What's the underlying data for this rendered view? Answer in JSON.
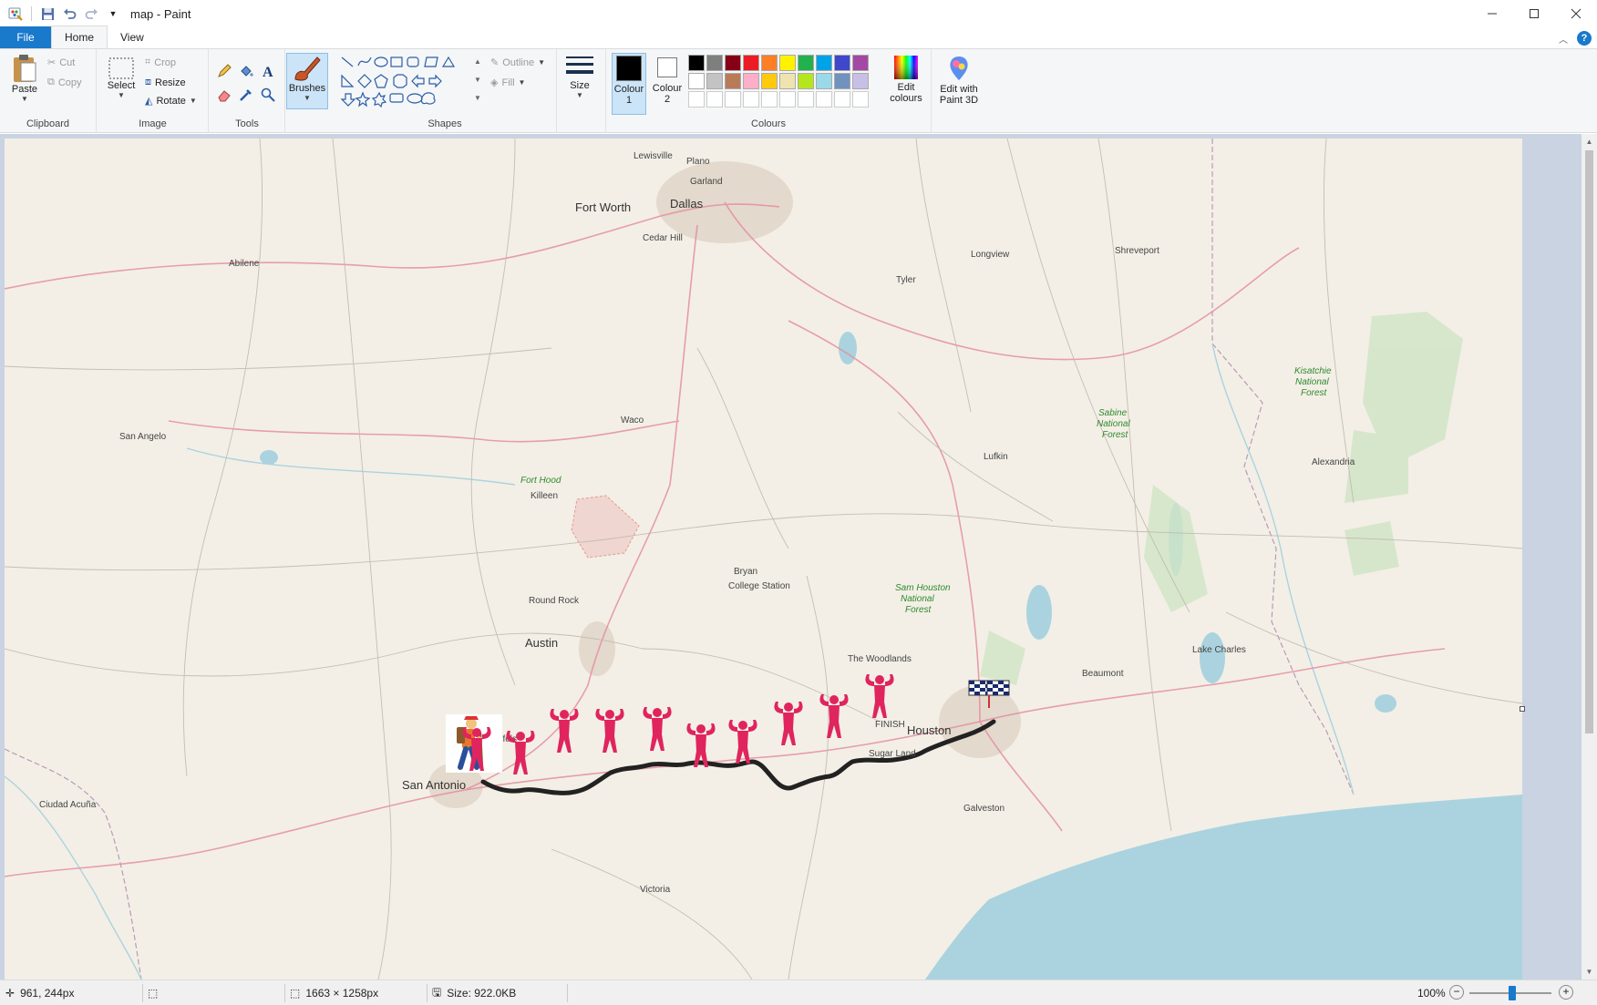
{
  "window": {
    "title": "map - Paint",
    "minimize_icon": "minimize-icon",
    "maximize_icon": "maximize-icon",
    "close_icon": "close-icon"
  },
  "tabs": [
    "File",
    "Home",
    "View"
  ],
  "ribbon": {
    "clipboard": {
      "label": "Clipboard",
      "paste": "Paste",
      "cut": "Cut",
      "copy": "Copy"
    },
    "image": {
      "label": "Image",
      "select": "Select",
      "crop": "Crop",
      "resize": "Resize",
      "rotate": "Rotate"
    },
    "tools": {
      "label": "Tools"
    },
    "brushes": "Brushes",
    "shapes": {
      "label": "Shapes",
      "outline": "Outline",
      "fill": "Fill"
    },
    "size": "Size",
    "colours": {
      "label": "Colours",
      "colour1": "Colour 1",
      "colour2": "Colour 2",
      "edit_colours": "Edit colours",
      "row1": [
        "#000000",
        "#7f7f7f",
        "#880015",
        "#ed1c24",
        "#ff7f27",
        "#fff200",
        "#22b14c",
        "#00a2e8",
        "#3f48cc",
        "#a349a4"
      ],
      "row2": [
        "#ffffff",
        "#c3c3c3",
        "#b97a57",
        "#ffaec9",
        "#ffc90e",
        "#efe4b0",
        "#b5e61d",
        "#99d9ea",
        "#7092be",
        "#c8bfe7"
      ]
    },
    "paint3d": "Edit with Paint 3D"
  },
  "map": {
    "labels": [
      {
        "name": "Lewisville",
        "cls": ""
      },
      {
        "name": "Plano",
        "cls": ""
      },
      {
        "name": "Garland",
        "cls": ""
      },
      {
        "name": "Fort Worth",
        "cls": "big"
      },
      {
        "name": "Dallas",
        "cls": "big"
      },
      {
        "name": "Cedar Hill",
        "cls": ""
      },
      {
        "name": "Abilene",
        "cls": ""
      },
      {
        "name": "Longview",
        "cls": ""
      },
      {
        "name": "Shreveport",
        "cls": ""
      },
      {
        "name": "Tyler",
        "cls": ""
      },
      {
        "name": "Kisatchie",
        "cls": "green"
      },
      {
        "name": "National",
        "cls": "green"
      },
      {
        "name": "Forest",
        "cls": "green"
      },
      {
        "name": "San Angelo",
        "cls": ""
      },
      {
        "name": "Waco",
        "cls": ""
      },
      {
        "name": "Sabine",
        "cls": "green"
      },
      {
        "name": "National",
        "cls": "green"
      },
      {
        "name": "Forest",
        "cls": "green"
      },
      {
        "name": "Lufkin",
        "cls": ""
      },
      {
        "name": "Alexandria",
        "cls": ""
      },
      {
        "name": "Fort Hood",
        "cls": "green"
      },
      {
        "name": "Killeen",
        "cls": ""
      },
      {
        "name": "Bryan",
        "cls": ""
      },
      {
        "name": "College Station",
        "cls": ""
      },
      {
        "name": "Sam Houston",
        "cls": "green"
      },
      {
        "name": "National",
        "cls": "green"
      },
      {
        "name": "Forest",
        "cls": "green"
      },
      {
        "name": "Round Rock",
        "cls": ""
      },
      {
        "name": "Austin",
        "cls": "big"
      },
      {
        "name": "The Woodlands",
        "cls": ""
      },
      {
        "name": "Lake Charles",
        "cls": ""
      },
      {
        "name": "Beaumont",
        "cls": ""
      },
      {
        "name": "New Braunfels",
        "cls": ""
      },
      {
        "name": "San Antonio",
        "cls": "big"
      },
      {
        "name": "Sugar Land",
        "cls": ""
      },
      {
        "name": "Houston",
        "cls": "big"
      },
      {
        "name": "FINISH",
        "cls": ""
      },
      {
        "name": "Ciudad Acuña",
        "cls": ""
      },
      {
        "name": "Galveston",
        "cls": ""
      },
      {
        "name": "Victoria",
        "cls": ""
      }
    ]
  },
  "status": {
    "cursor": "961, 244px",
    "dimensions": "1663 × 1258px",
    "size": "Size: 922.0KB",
    "zoom": "100%",
    "zoom_level": 100
  }
}
